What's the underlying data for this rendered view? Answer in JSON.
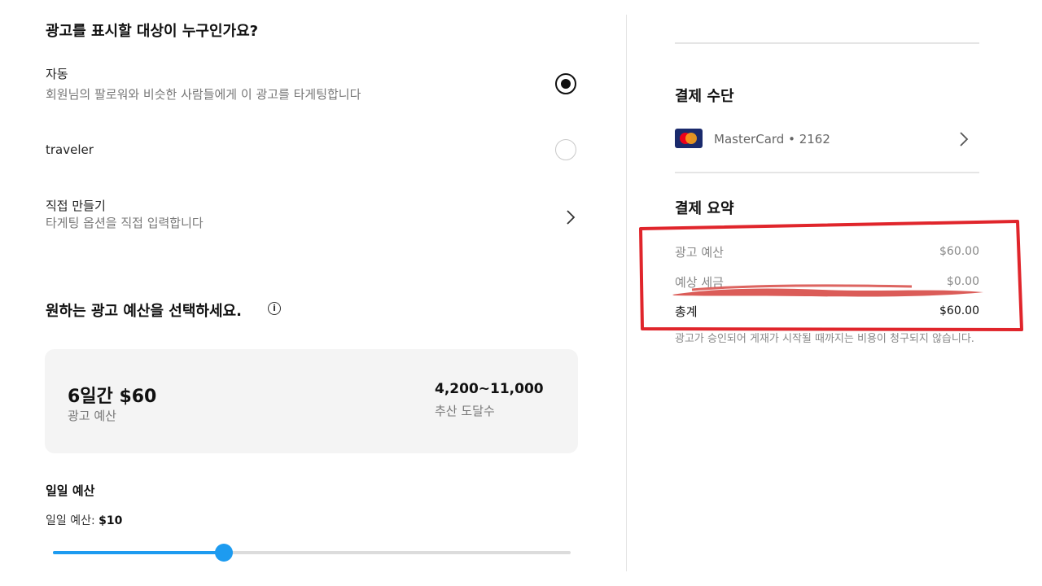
{
  "targeting": {
    "title": "광고를 표시할 대상이 누구인가요?",
    "options": [
      {
        "label": "자동",
        "description": "회원님의 팔로워와 비슷한 사람들에게 이 광고를 타게팅합니다",
        "selected": true
      },
      {
        "label": "traveler",
        "selected": false
      },
      {
        "label": "직접 만들기",
        "description": "타게팅 옵션을 직접 입력합니다"
      }
    ]
  },
  "budget": {
    "title": "원하는 광고 예산을 선택하세요.",
    "info_icon": "info-icon",
    "amount": "6일간 $60",
    "amount_caption": "광고 예산",
    "reach": "4,200~11,000",
    "reach_caption": "추산 도달수",
    "daily_title": "일일 예산",
    "daily_label": "일일 예산: ",
    "daily_value": "$10",
    "slider_fraction": 0.33
  },
  "payment": {
    "title": "결제 수단",
    "card_text": "MasterCard • 2162",
    "card_icon": "mastercard-icon"
  },
  "summary": {
    "title": "결제 요약",
    "rows": [
      {
        "label": "광고 예산",
        "value": "$60.00"
      },
      {
        "label": "예상 세금",
        "value": "$0.00"
      }
    ],
    "total_label": "총계",
    "total_value": "$60.00",
    "note": "광고가 승인되어 게재가 시작될 때까지는 비용이 청구되지 않습니다."
  },
  "colors": {
    "accent": "#1d9bf0",
    "annotation_red": "#e0252b",
    "redaction": "#d9534f"
  }
}
